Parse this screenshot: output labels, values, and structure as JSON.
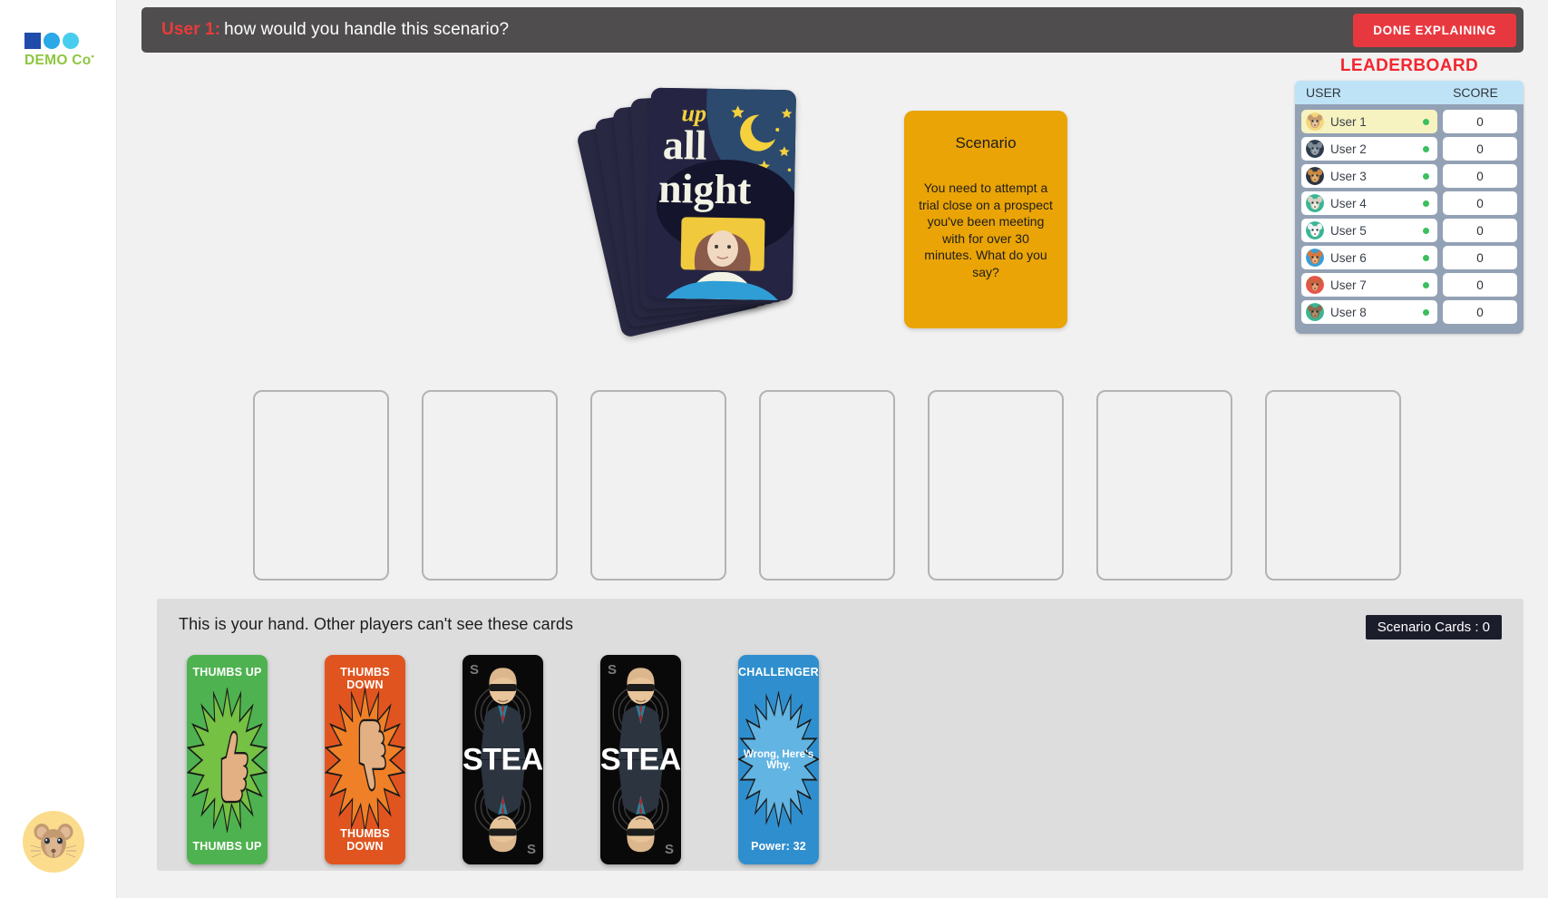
{
  "brand": {
    "name": "DEMO Co",
    "superscript": "•",
    "square_color": "#1f4bab",
    "circle1_color": "#2aa8e8",
    "circle2_color": "#49cdee",
    "text_color": "#8dc63f"
  },
  "user_avatar": {
    "icon": "mouse-avatar-icon",
    "bg_color": "#fbdc8c"
  },
  "topbar": {
    "speaker": "User 1:",
    "message": "how would you handle this scenario?",
    "speaker_color": "#ea3b3b",
    "bg_color": "#4f4d4d",
    "done_label": "DONE EXPLAINING",
    "done_color": "#e8383f"
  },
  "leaderboard": {
    "title": "LEADERBOARD",
    "title_color": "#f3262f",
    "col_user": "USER",
    "col_score": "SCORE",
    "rows": [
      {
        "name": "User 1",
        "score": "0",
        "online": true,
        "is_me": true,
        "avatar": "mouse-avatar-icon",
        "avatar_bg": "#f5d77a"
      },
      {
        "name": "User 2",
        "score": "0",
        "online": true,
        "is_me": false,
        "avatar": "elephant-avatar-icon",
        "avatar_bg": "#2e3b4e"
      },
      {
        "name": "User 3",
        "score": "0",
        "online": true,
        "is_me": false,
        "avatar": "cheetah-avatar-icon",
        "avatar_bg": "#2b3442"
      },
      {
        "name": "User 4",
        "score": "0",
        "online": true,
        "is_me": false,
        "avatar": "leopard-avatar-icon",
        "avatar_bg": "#3ab595"
      },
      {
        "name": "User 5",
        "score": "0",
        "online": true,
        "is_me": false,
        "avatar": "dalmatian-avatar-icon",
        "avatar_bg": "#3ab595"
      },
      {
        "name": "User 6",
        "score": "0",
        "online": true,
        "is_me": false,
        "avatar": "fox-avatar-icon",
        "avatar_bg": "#3b9ed6"
      },
      {
        "name": "User 7",
        "score": "0",
        "online": true,
        "is_me": false,
        "avatar": "antelope-avatar-icon",
        "avatar_bg": "#e8544a"
      },
      {
        "name": "User 8",
        "score": "0",
        "online": true,
        "is_me": false,
        "avatar": "deer-avatar-icon",
        "avatar_bg": "#3ab595"
      }
    ],
    "online_dot_color": "#3cbf5e",
    "header_bg": "#bfe3f6",
    "box_bg": "#93a1b5",
    "highlight_bg": "#f6f3c0"
  },
  "deck": {
    "card_count": 5,
    "art_title_line1": "up",
    "art_title_line2": "all",
    "art_title_line3": "night",
    "bg_color": "#282843"
  },
  "scenario": {
    "title": "Scenario",
    "body": "You need to attempt a trial close on a prospect you've been meeting with for over 30 minutes. What do you say?",
    "bg_color": "#eaa406"
  },
  "play_slots": {
    "count": 7
  },
  "hand": {
    "label": "This is your hand. Other players can't see these cards",
    "scenario_count_label": "Scenario Cards : 0",
    "panel_bg": "#dddddd",
    "cards": [
      {
        "kind": "thumbs-up",
        "top_label": "THUMBS UP",
        "bottom_label": "THUMBS UP",
        "bg": "#4fb250",
        "burst": "#74c143"
      },
      {
        "kind": "thumbs-down",
        "top_label": "THUMBS DOWN",
        "bottom_label": "THUMBS DOWN",
        "bg": "#e0551f",
        "burst": "#f08027"
      },
      {
        "kind": "steal",
        "top_label": "S",
        "bottom_label": "S",
        "word": "STEAL",
        "bg": "#090909"
      },
      {
        "kind": "steal",
        "top_label": "S",
        "bottom_label": "S",
        "word": "STEAL",
        "bg": "#090909"
      },
      {
        "kind": "challenger",
        "top_label": "CHALLENGER!",
        "middle_label": "Wrong, Here's Why.",
        "bottom_label": "Power: 32",
        "bg": "#2f8fce",
        "burst": "#62b4e2"
      }
    ]
  }
}
